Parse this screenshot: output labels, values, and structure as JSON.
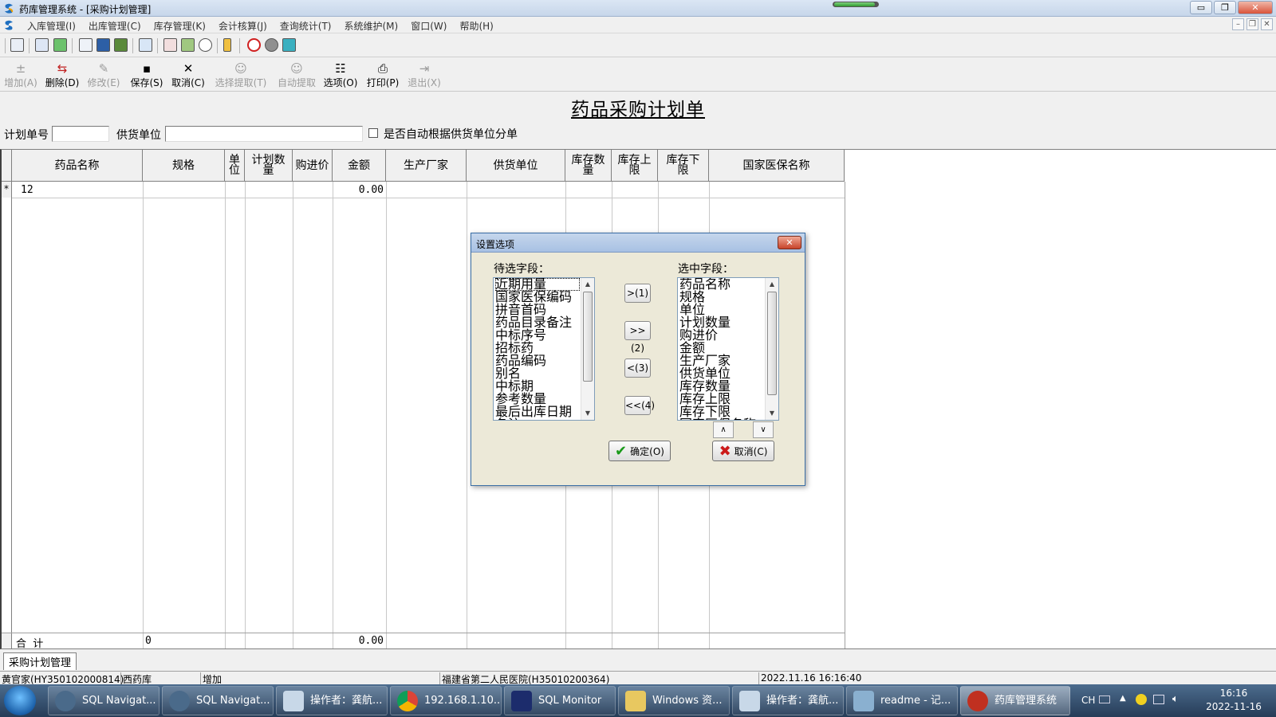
{
  "window": {
    "title": "药库管理系统 - [采购计划管理]",
    "progress_fraction": 0.95,
    "minimize": "▭",
    "restore": "❐",
    "close": "✕"
  },
  "menu": {
    "items": [
      "入库管理(I)",
      "出库管理(C)",
      "库存管理(K)",
      "会计核算(J)",
      "查询统计(T)",
      "系统维护(M)",
      "窗口(W)",
      "帮助(H)"
    ],
    "mdi_min": "–",
    "mdi_restore": "❐",
    "mdi_close": "✕"
  },
  "actions": [
    {
      "label": "增加(A)",
      "glyph": "±",
      "enabled": false
    },
    {
      "label": "删除(D)",
      "glyph": "⇆",
      "enabled": true
    },
    {
      "label": "修改(E)",
      "glyph": "✎",
      "enabled": false
    },
    {
      "label": "保存(S)",
      "glyph": "▪",
      "enabled": true
    },
    {
      "label": "取消(C)",
      "glyph": "✕",
      "enabled": true
    },
    {
      "label": "选择提取(T)",
      "glyph": "☺",
      "enabled": false
    },
    {
      "label": "自动提取",
      "glyph": "☺",
      "enabled": false
    },
    {
      "label": "选项(O)",
      "glyph": "☷",
      "enabled": true
    },
    {
      "label": "打印(P)",
      "glyph": "⎙",
      "enabled": true
    },
    {
      "label": "退出(X)",
      "glyph": "⇥",
      "enabled": false
    }
  ],
  "form": {
    "title": "药品采购计划单",
    "plan_no_label": "计划单号",
    "plan_no_value": "",
    "supplier_label": "供货单位",
    "supplier_value": "",
    "auto_split_label": "是否自动根据供货单位分单"
  },
  "grid": {
    "columns": [
      {
        "line1": "药品名称",
        "line2": ""
      },
      {
        "line1": "规格",
        "line2": ""
      },
      {
        "line1": "单",
        "line2": "位"
      },
      {
        "line1": "计划数",
        "line2": "量"
      },
      {
        "line1": "购进价",
        "line2": ""
      },
      {
        "line1": "金额",
        "line2": ""
      },
      {
        "line1": "生产厂家",
        "line2": ""
      },
      {
        "line1": "供货单位",
        "line2": ""
      },
      {
        "line1": "库存数",
        "line2": "量"
      },
      {
        "line1": "库存上",
        "line2": "限"
      },
      {
        "line1": "库存下",
        "line2": "限"
      },
      {
        "line1": "国家医保名称",
        "line2": ""
      }
    ],
    "row": {
      "marker": "*",
      "name": "12",
      "amount": "0.00"
    },
    "total": {
      "label": "合  计",
      "spec": "0",
      "amount": "0.00"
    }
  },
  "tab": {
    "label": "采购计划管理"
  },
  "status": {
    "user": "黄官家(HY350102000814)",
    "warehouse": "西药库",
    "mode": "增加",
    "hospital": "福建省第二人民医院(H35010200364)",
    "datetime": "2022.11.16 16:16:40"
  },
  "dialog": {
    "title": "设置选项",
    "close": "✕",
    "available_label": "待选字段：",
    "selected_label": "选中字段：",
    "available": [
      "近期用量",
      "国家医保编码",
      "拼音首码",
      "药品目录备注",
      "中标序号",
      "招标药",
      "药品编码",
      "别名",
      "中标期",
      "参考数量",
      "最后出库日期",
      "备注"
    ],
    "selected": [
      "药品名称",
      "规格",
      "单位",
      "计划数量",
      "购进价",
      "金额",
      "生产厂家",
      "供货单位",
      "库存数量",
      "库存上限",
      "库存下限",
      "国家医保名称"
    ],
    "btn_add_one": ">(1)",
    "btn_add_all": ">>(2)",
    "btn_remove_one": "<(3)",
    "btn_remove_all": "<<(4)",
    "btn_up": "∧",
    "btn_down": "∨",
    "ok": "确定(O)",
    "cancel": "取消(C)"
  },
  "taskbar": {
    "tasks": [
      {
        "label": "SQL Navigat...",
        "color": "#4a6a8a"
      },
      {
        "label": "SQL Navigat...",
        "color": "#4a6a8a"
      },
      {
        "label": "操作者：龚航...",
        "color": "#c8d8e8"
      },
      {
        "label": "192.168.1.10...",
        "color": "#e0a020"
      },
      {
        "label": "SQL Monitor",
        "color": "#1c2c6c"
      },
      {
        "label": "Windows 资...",
        "color": "#e8c860"
      },
      {
        "label": "操作者：龚航...",
        "color": "#c8d8e8"
      },
      {
        "label": "readme - 记...",
        "color": "#8ab0d0"
      },
      {
        "label": "药库管理系统",
        "color": "#c03020"
      }
    ],
    "lang": "CH",
    "time": "16:16",
    "date": "2022-11-16"
  }
}
